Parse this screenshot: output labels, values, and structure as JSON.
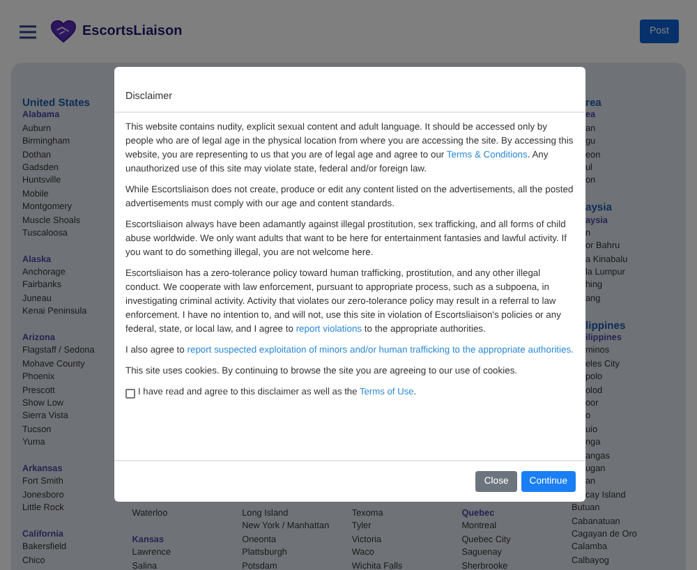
{
  "header": {
    "brand": "EscortsLiaison",
    "post_button": "Post"
  },
  "columns": [
    {
      "groups": [
        {
          "heading": "United States",
          "subheading": "Alabama",
          "items": [
            "Auburn",
            "Birmingham",
            "Dothan",
            "Gadsden",
            "Huntsville",
            "Mobile",
            "Montgomery",
            "Muscle Shoals",
            "Tuscaloosa"
          ]
        },
        {
          "subheading": "Alaska",
          "items": [
            "Anchorage",
            "Fairbanks",
            "Juneau",
            "Kenai Peninsula"
          ]
        },
        {
          "subheading": "Arizona",
          "items": [
            "Flagstaff / Sedona",
            "Mohave County",
            "Phoenix",
            "Prescott",
            "Show Low",
            "Sierra Vista",
            "Tucson",
            "Yuma"
          ]
        },
        {
          "subheading": "Arkansas",
          "items": [
            "Fort Smith",
            "Jonesboro",
            "Little Rock"
          ]
        },
        {
          "subheading": "California",
          "items": [
            "Bakersfield",
            "Chico"
          ]
        }
      ]
    },
    {
      "groups": [
        {
          "items": [
            "Waterloo"
          ]
        },
        {
          "subheading": "Kansas",
          "items": [
            "Lawrence",
            "Salina"
          ]
        }
      ]
    },
    {
      "groups": [
        {
          "items": [
            "Long Island",
            "New York / Manhattan",
            "Oneonta",
            "Plattsburgh",
            "Potsdam"
          ]
        }
      ]
    },
    {
      "groups": [
        {
          "items": [
            "Texoma",
            "Tyler",
            "Victoria",
            "Waco",
            "Wichita Falls"
          ]
        }
      ]
    },
    {
      "groups": [
        {
          "subheading": "Quebec",
          "items": [
            "Montreal",
            "Quebec City",
            "Saguenay",
            "Sherbrooke"
          ]
        }
      ]
    },
    {
      "groups": [
        {
          "heading": "rea",
          "subheading": "ea",
          "items": [
            "an",
            "gu",
            "eon",
            "ul",
            "on"
          ]
        },
        {
          "heading": "aysia",
          "subheading": "aysia",
          "items": [
            "n",
            "or Bahru",
            "a Kinabalu",
            "la Lumpur",
            "hing",
            "ang"
          ]
        },
        {
          "heading": "lippines",
          "subheading": "ilippines",
          "items": [
            "minos",
            "eles City",
            "polo",
            "olod",
            "oor",
            "o",
            "uio",
            "nga",
            "angas",
            "ugan",
            "an",
            "cay Island",
            "Butuan",
            "Cabanatuan",
            "Cagayan de Oro",
            "Calamba",
            "Calbayog"
          ]
        }
      ]
    }
  ],
  "modal": {
    "title": "Disclaimer",
    "paragraphs": [
      [
        {
          "kind": "text",
          "text": "This website contains nudity, explicit sexual content and adult language. It should be accessed only by people who are of legal age in the physical location from where you are accessing the site. By accessing this website, you are representing to us that you are of legal age and agree to our "
        },
        {
          "kind": "link",
          "text": "Terms & Conditions"
        },
        {
          "kind": "text",
          "text": ". Any unauthorized use of this site may violate state, federal and/or foreign law."
        }
      ],
      [
        {
          "kind": "text",
          "text": "While Escortsliaison does not create, produce or edit any content listed on the advertisements, all the posted advertisements must comply with our age and content standards."
        }
      ],
      [
        {
          "kind": "text",
          "text": "Escortsliaison always have been adamantly against illegal prostitution, sex trafficking, and all forms of child abuse worldwide. We only want adults that want to be here for entertainment fantasies and lawful activity. If you want to do something illegal, you are not welcome here."
        }
      ],
      [
        {
          "kind": "text",
          "text": "Escortsliaison has a zero-tolerance policy toward human trafficking, prostitution, and any other illegal conduct. We cooperate with law enforcement, pursuant to appropriate process, such as a subpoena, in investigating criminal activity. Activity that violates our zero-tolerance policy may result in a referral to law enforcement. I have no intention to, and will not, use this site in violation of Escortsliaison's policies or any federal, state, or local law, and I agree to "
        },
        {
          "kind": "link",
          "text": "report violations"
        },
        {
          "kind": "text",
          "text": " to the appropriate authorities."
        }
      ],
      [
        {
          "kind": "text",
          "text": "I also agree to "
        },
        {
          "kind": "link",
          "text": "report suspected exploitation of minors and/or human trafficking to the appropriate authorities."
        }
      ],
      [
        {
          "kind": "text",
          "text": "This site uses cookies. By continuing to browse the site you are agreeing to our use of cookies."
        }
      ]
    ],
    "agree": {
      "checked": false,
      "segments": [
        {
          "kind": "text",
          "text": "I have read and agree to this disclaimer as well as the "
        },
        {
          "kind": "link",
          "text": "Terms of Use"
        },
        {
          "kind": "text",
          "text": "."
        }
      ]
    },
    "buttons": [
      {
        "label": "Close",
        "kind": "secondary"
      },
      {
        "label": "Continue",
        "kind": "primary"
      }
    ]
  }
}
